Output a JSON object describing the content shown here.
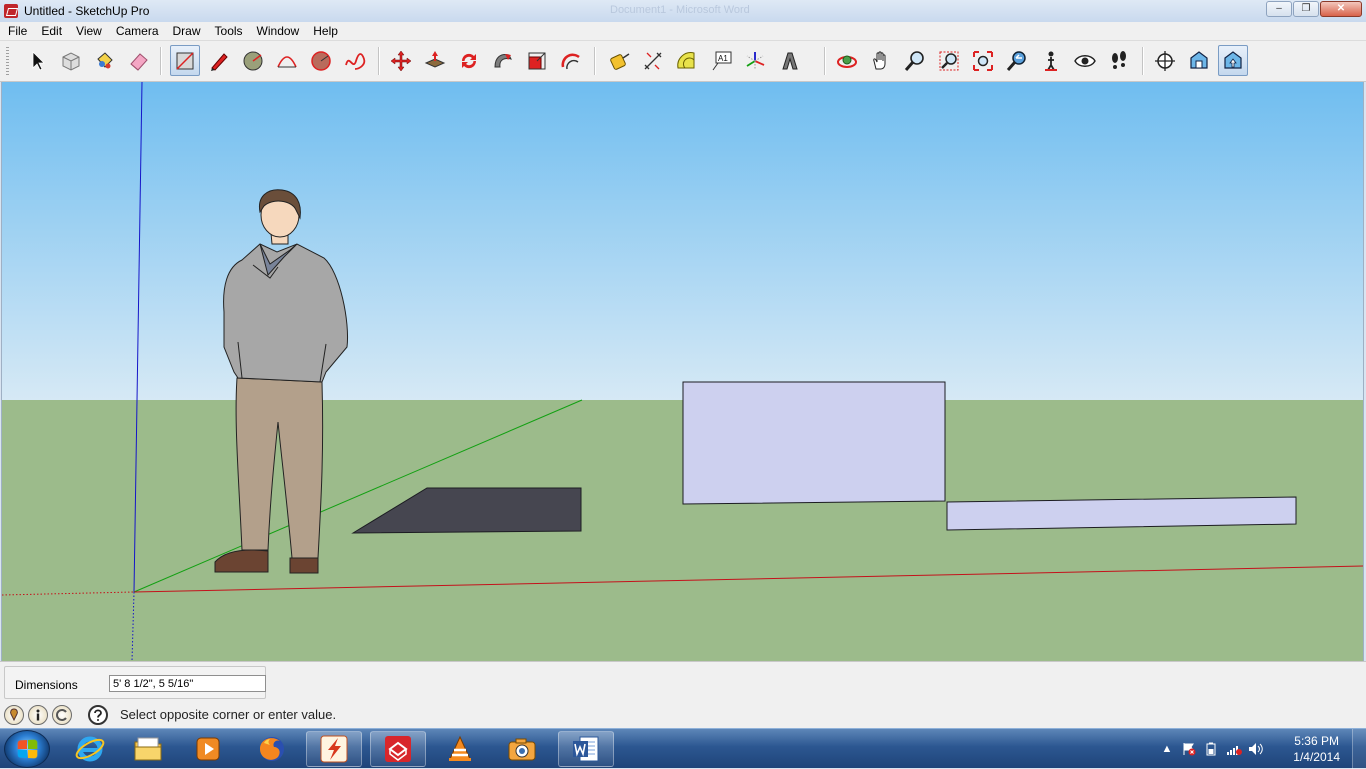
{
  "window": {
    "title": "Untitled - SketchUp Pro",
    "ghost_title": "Document1 - Microsoft Word",
    "controls": {
      "minimize": "–",
      "maximize": "❐",
      "close": "✕"
    }
  },
  "menu": [
    "File",
    "Edit",
    "View",
    "Camera",
    "Draw",
    "Tools",
    "Window",
    "Help"
  ],
  "toolbar": {
    "tools": [
      {
        "name": "select",
        "icon": "arrow-cursor-icon"
      },
      {
        "name": "make-component",
        "icon": "component-box-icon"
      },
      {
        "name": "paint-bucket",
        "icon": "paint-bucket-icon"
      },
      {
        "name": "eraser",
        "icon": "eraser-icon"
      },
      {
        "name": "rectangle",
        "icon": "rectangle-icon",
        "active": true
      },
      {
        "name": "line",
        "icon": "pencil-icon"
      },
      {
        "name": "circle",
        "icon": "circle-icon"
      },
      {
        "name": "arc",
        "icon": "arc-icon"
      },
      {
        "name": "polygon",
        "icon": "polygon-icon"
      },
      {
        "name": "freehand",
        "icon": "freehand-icon"
      },
      {
        "name": "move",
        "icon": "move-arrows-icon"
      },
      {
        "name": "push-pull",
        "icon": "push-pull-icon"
      },
      {
        "name": "rotate",
        "icon": "rotate-icon"
      },
      {
        "name": "follow-me",
        "icon": "follow-me-icon"
      },
      {
        "name": "scale",
        "icon": "scale-icon"
      },
      {
        "name": "offset",
        "icon": "offset-icon"
      },
      {
        "name": "tape-measure",
        "icon": "tape-measure-icon"
      },
      {
        "name": "dimension",
        "icon": "dimension-icon"
      },
      {
        "name": "protractor",
        "icon": "protractor-icon"
      },
      {
        "name": "text",
        "icon": "text-label-icon",
        "label": "A1"
      },
      {
        "name": "axes",
        "icon": "axes-icon"
      },
      {
        "name": "3d-text",
        "icon": "3d-text-icon",
        "label": "A"
      },
      {
        "name": "orbit",
        "icon": "orbit-icon"
      },
      {
        "name": "pan",
        "icon": "hand-icon"
      },
      {
        "name": "zoom",
        "icon": "zoom-icon"
      },
      {
        "name": "zoom-window",
        "icon": "zoom-window-icon"
      },
      {
        "name": "zoom-extents",
        "icon": "zoom-extents-icon"
      },
      {
        "name": "previous",
        "icon": "previous-view-icon"
      },
      {
        "name": "position-camera",
        "icon": "position-camera-icon"
      },
      {
        "name": "look-around",
        "icon": "eye-icon"
      },
      {
        "name": "walk",
        "icon": "footprints-icon"
      },
      {
        "name": "section-plane",
        "icon": "section-plane-icon"
      },
      {
        "name": "warehouse",
        "icon": "3d-warehouse-icon"
      },
      {
        "name": "share-model",
        "icon": "share-model-icon",
        "active": true
      }
    ]
  },
  "measurements": {
    "label": "Dimensions",
    "value": "5' 8 1/2\", 5 5/16\""
  },
  "status": {
    "icons": [
      "geo-location-icon",
      "credits-icon",
      "account-icon",
      "help-icon"
    ],
    "message": "Select opposite corner or enter value."
  },
  "taskbar": {
    "apps": [
      "internet-explorer-icon",
      "file-explorer-icon",
      "media-player-icon",
      "firefox-icon",
      "flash-app-icon",
      "sketchup-icon",
      "vlc-icon",
      "camera-app-icon",
      "word-icon"
    ],
    "clock_time": "5:36 PM",
    "clock_date": "1/4/2014"
  },
  "colors": {
    "sky_top": "#6fbdf0",
    "sky_bottom": "#d6e9f5",
    "ground": "#9cbb8b",
    "face_front": "#cdd0ef",
    "face_dark": "#464650",
    "axis_red": "#c4111b",
    "axis_green": "#12a012",
    "axis_blue": "#1515c8"
  }
}
